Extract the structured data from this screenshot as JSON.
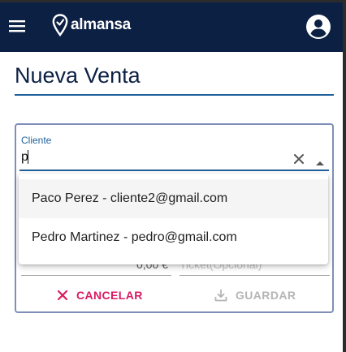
{
  "header": {
    "brand_name": "almansa",
    "menu_icon": "hamburger-menu-icon",
    "account_icon": "account-circle-icon",
    "background": "#0c2044"
  },
  "page": {
    "title": "Nueva Venta"
  },
  "form": {
    "client_label": "Cliente",
    "client_value": "p",
    "clear_icon": "close-icon",
    "toggle_icon": "arrow-up-icon",
    "amount_value": "0,00 €",
    "ticket_placeholder": "Ticket(Opcional)",
    "cancel_label": "CANCELAR",
    "save_label": "GUARDAR",
    "accent": "#1f5f9a",
    "cancel_color": "#d81b60"
  },
  "dropdown": {
    "options": [
      "Paco Perez - cliente2@gmail.com",
      "Pedro Martinez - pedro@gmail.com"
    ]
  }
}
